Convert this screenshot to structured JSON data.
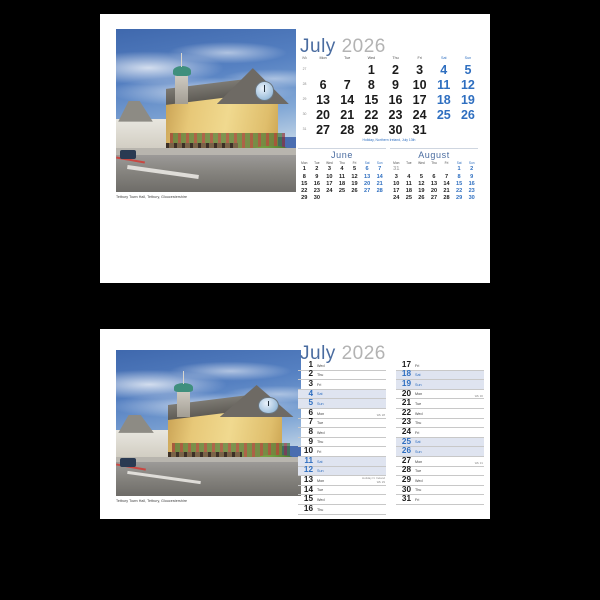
{
  "meta": {
    "background_color": "#000000",
    "card_color": "#ffffff",
    "accent_blue": "#2f6fc0",
    "title_blue": "#4a6ca0",
    "title_gray": "#b3b3b3",
    "weekend_row_fill": "#dfe4f0"
  },
  "photo": {
    "caption": "Tetbury Town Hall, Tetbury, Gloucestershire",
    "alt_name": "tetbury-town-hall-photo"
  },
  "title": {
    "month": "July",
    "year": "2026"
  },
  "grid": {
    "headers": [
      "Wk",
      "Mon",
      "Tue",
      "Wed",
      "Thu",
      "Fri",
      "Sat",
      "Sun"
    ],
    "weekend_headers": [
      "Sat",
      "Sun"
    ],
    "weeks": [
      {
        "wk": "27",
        "days": [
          "",
          "",
          "1",
          "2",
          "3",
          "4",
          "5"
        ]
      },
      {
        "wk": "28",
        "days": [
          "6",
          "7",
          "8",
          "9",
          "10",
          "11",
          "12"
        ]
      },
      {
        "wk": "29",
        "days": [
          "13",
          "14",
          "15",
          "16",
          "17",
          "18",
          "19"
        ]
      },
      {
        "wk": "30",
        "days": [
          "20",
          "21",
          "22",
          "23",
          "24",
          "25",
          "26"
        ]
      },
      {
        "wk": "31",
        "days": [
          "27",
          "28",
          "29",
          "30",
          "31",
          "",
          ""
        ]
      }
    ]
  },
  "holiday_note": "Holiday, Northern Ireland, July 13th",
  "mini_months": [
    {
      "name": "June",
      "headers": [
        "Mon",
        "Tue",
        "Wed",
        "Thu",
        "Fri",
        "Sat",
        "Sun"
      ],
      "weeks": [
        [
          "1",
          "2",
          "3",
          "4",
          "5",
          "6",
          "7"
        ],
        [
          "8",
          "9",
          "10",
          "11",
          "12",
          "13",
          "14"
        ],
        [
          "15",
          "16",
          "17",
          "18",
          "19",
          "20",
          "21"
        ],
        [
          "22",
          "23",
          "24",
          "25",
          "26",
          "27",
          "28"
        ],
        [
          "29",
          "30",
          "",
          "",
          "",
          "",
          ""
        ]
      ],
      "outside": []
    },
    {
      "name": "August",
      "headers": [
        "Mon",
        "Tue",
        "Wed",
        "Thu",
        "Fri",
        "Sat",
        "Sun"
      ],
      "weeks": [
        [
          "31",
          "",
          "",
          "",
          "",
          "1",
          "2"
        ],
        [
          "3",
          "4",
          "5",
          "6",
          "7",
          "8",
          "9"
        ],
        [
          "10",
          "11",
          "12",
          "13",
          "14",
          "15",
          "16"
        ],
        [
          "17",
          "18",
          "19",
          "20",
          "21",
          "22",
          "23"
        ],
        [
          "24",
          "25",
          "26",
          "27",
          "28",
          "29",
          "30"
        ]
      ],
      "outside": [
        "0-0"
      ]
    }
  ],
  "day_list": {
    "left": [
      {
        "num": "1",
        "dow": "Wed",
        "weekend": false,
        "wk": "",
        "note": ""
      },
      {
        "num": "2",
        "dow": "Thu",
        "weekend": false,
        "wk": "",
        "note": ""
      },
      {
        "num": "3",
        "dow": "Fri",
        "weekend": false,
        "wk": "",
        "note": ""
      },
      {
        "num": "4",
        "dow": "Sat",
        "weekend": true,
        "wk": "",
        "note": ""
      },
      {
        "num": "5",
        "dow": "Sun",
        "weekend": true,
        "wk": "",
        "note": ""
      },
      {
        "num": "6",
        "dow": "Mon",
        "weekend": false,
        "wk": "Wk 28",
        "note": ""
      },
      {
        "num": "7",
        "dow": "Tue",
        "weekend": false,
        "wk": "",
        "note": ""
      },
      {
        "num": "8",
        "dow": "Wed",
        "weekend": false,
        "wk": "",
        "note": ""
      },
      {
        "num": "9",
        "dow": "Thu",
        "weekend": false,
        "wk": "",
        "note": ""
      },
      {
        "num": "10",
        "dow": "Fri",
        "weekend": false,
        "wk": "",
        "note": ""
      },
      {
        "num": "11",
        "dow": "Sat",
        "weekend": true,
        "wk": "",
        "note": ""
      },
      {
        "num": "12",
        "dow": "Sun",
        "weekend": true,
        "wk": "",
        "note": ""
      },
      {
        "num": "13",
        "dow": "Mon",
        "weekend": false,
        "wk": "Wk 29",
        "note": "Holiday N. Ireland"
      },
      {
        "num": "14",
        "dow": "Tue",
        "weekend": false,
        "wk": "",
        "note": ""
      },
      {
        "num": "15",
        "dow": "Wed",
        "weekend": false,
        "wk": "",
        "note": ""
      },
      {
        "num": "16",
        "dow": "Thu",
        "weekend": false,
        "wk": "",
        "note": ""
      }
    ],
    "right": [
      {
        "num": "17",
        "dow": "Fri",
        "weekend": false,
        "wk": "",
        "note": ""
      },
      {
        "num": "18",
        "dow": "Sat",
        "weekend": true,
        "wk": "",
        "note": ""
      },
      {
        "num": "19",
        "dow": "Sun",
        "weekend": true,
        "wk": "",
        "note": ""
      },
      {
        "num": "20",
        "dow": "Mon",
        "weekend": false,
        "wk": "Wk 30",
        "note": ""
      },
      {
        "num": "21",
        "dow": "Tue",
        "weekend": false,
        "wk": "",
        "note": ""
      },
      {
        "num": "22",
        "dow": "Wed",
        "weekend": false,
        "wk": "",
        "note": ""
      },
      {
        "num": "23",
        "dow": "Thu",
        "weekend": false,
        "wk": "",
        "note": ""
      },
      {
        "num": "24",
        "dow": "Fri",
        "weekend": false,
        "wk": "",
        "note": ""
      },
      {
        "num": "25",
        "dow": "Sat",
        "weekend": true,
        "wk": "",
        "note": ""
      },
      {
        "num": "26",
        "dow": "Sun",
        "weekend": true,
        "wk": "",
        "note": ""
      },
      {
        "num": "27",
        "dow": "Mon",
        "weekend": false,
        "wk": "Wk 31",
        "note": ""
      },
      {
        "num": "28",
        "dow": "Tue",
        "weekend": false,
        "wk": "",
        "note": ""
      },
      {
        "num": "29",
        "dow": "Wed",
        "weekend": false,
        "wk": "",
        "note": ""
      },
      {
        "num": "30",
        "dow": "Thu",
        "weekend": false,
        "wk": "",
        "note": ""
      },
      {
        "num": "31",
        "dow": "Fri",
        "weekend": false,
        "wk": "",
        "note": ""
      }
    ]
  }
}
